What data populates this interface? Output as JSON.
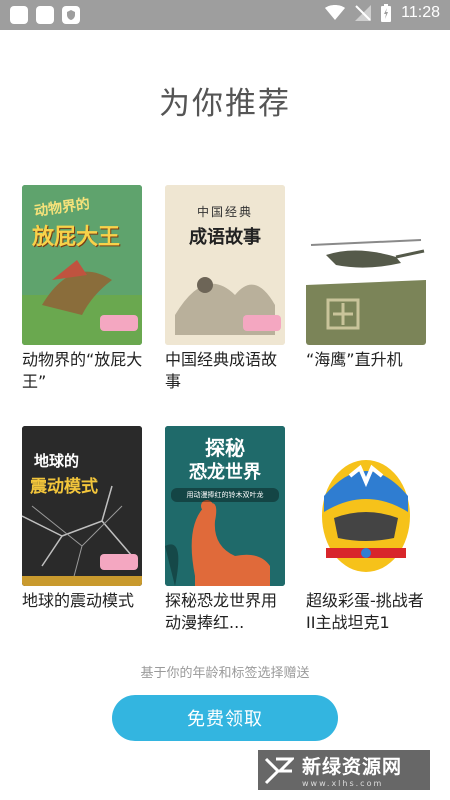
{
  "status_bar": {
    "time": "11:28"
  },
  "page": {
    "title": "为你推荐"
  },
  "books": [
    {
      "label": "动物界的“放屁大王”",
      "cover_title": "动物界的",
      "cover_subtitle": "放屁大王",
      "cover_color": "#3f8a56"
    },
    {
      "label": "中国经典成语故事",
      "cover_title": "中国经典",
      "cover_subtitle": "成语故事",
      "cover_color": "#efe6d2"
    },
    {
      "label": "“海鹰”直升机",
      "cover_color": "#6f7a4d"
    },
    {
      "label": "地球的震动模式",
      "cover_title": "地球的",
      "cover_subtitle": "震动模式",
      "cover_color": "#2a2a2a"
    },
    {
      "label": "探秘恐龙世界用动漫捧红...",
      "cover_title": "探秘",
      "cover_subtitle": "恐龙世界",
      "cover_tag": "用动漫捧红的铃木双叶龙",
      "cover_color": "#1f6a6a"
    },
    {
      "label": "超级彩蛋-挑战者II主战坦克1",
      "cover_color": "#f6c21a"
    }
  ],
  "hint_text": "基于你的年龄和标签选择赠送",
  "cta_label": "免费领取",
  "watermark": {
    "cn": "新绿资源网",
    "en": "www.xlhs.com"
  }
}
